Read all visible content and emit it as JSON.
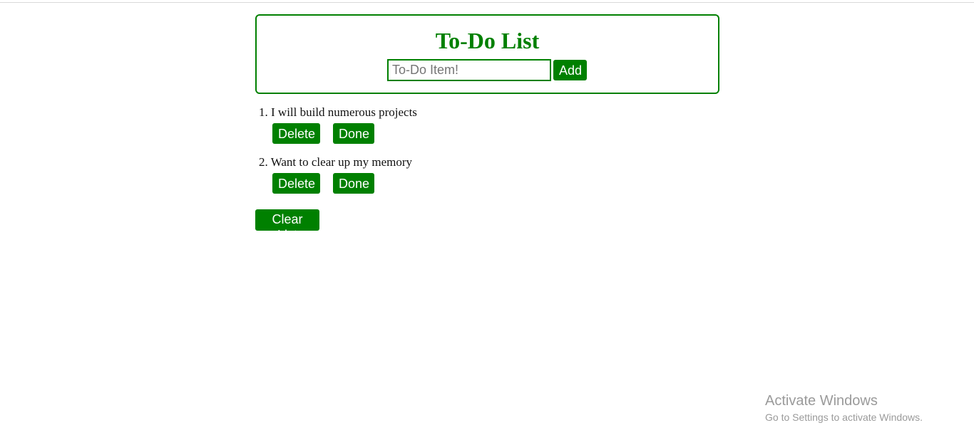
{
  "header": {
    "title": "To-Do List",
    "input_placeholder": "To-Do Item!",
    "input_value": "",
    "add_label": "Add"
  },
  "todos": [
    {
      "number": "1.",
      "text": "I will build numerous projects",
      "delete_label": "Delete",
      "done_label": "Done"
    },
    {
      "number": "2.",
      "text": "Want to clear up my memory",
      "delete_label": "Delete",
      "done_label": "Done"
    }
  ],
  "clear_label": "Clear List",
  "watermark": {
    "title": "Activate Windows",
    "subtitle": "Go to Settings to activate Windows."
  },
  "colors": {
    "accent": "#008000",
    "button_text": "#ffffff",
    "watermark": "#9a9a9a"
  }
}
